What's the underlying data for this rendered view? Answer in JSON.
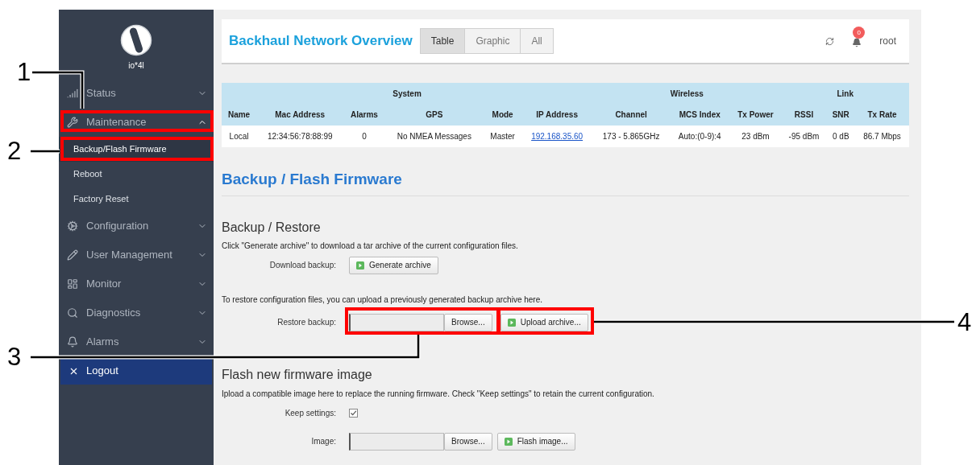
{
  "sidebar": {
    "logo_text": "io*4l",
    "items": [
      {
        "label": "Status",
        "expanded": false
      },
      {
        "label": "Maintenance",
        "expanded": true,
        "children": [
          {
            "label": "Backup/Flash Firmware",
            "selected": true
          },
          {
            "label": "Reboot",
            "selected": false
          },
          {
            "label": "Factory Reset",
            "selected": false
          }
        ]
      },
      {
        "label": "Configuration",
        "expanded": false
      },
      {
        "label": "User Management",
        "expanded": false
      },
      {
        "label": "Monitor",
        "expanded": false
      },
      {
        "label": "Diagnostics",
        "expanded": false
      },
      {
        "label": "Alarms",
        "expanded": false
      }
    ],
    "logout": "Logout"
  },
  "header": {
    "title": "Backhaul Network Overview",
    "tabs": [
      {
        "label": "Table",
        "selected": true
      },
      {
        "label": "Graphic",
        "selected": false
      },
      {
        "label": "All",
        "selected": false
      }
    ],
    "notification_count": "0",
    "user": "root"
  },
  "table": {
    "groups": [
      {
        "label": "System",
        "columns": [
          "Name",
          "Mac Address",
          "Alarms",
          "GPS",
          "Mode",
          "IP Address"
        ]
      },
      {
        "label": "Wireless",
        "columns": [
          "Channel",
          "MCS Index",
          "Tx Power"
        ]
      },
      {
        "label": "Link",
        "columns": [
          "RSSI",
          "SNR",
          "Tx Rate"
        ]
      }
    ],
    "rows": [
      [
        {
          "text": "Local",
          "kind": "text"
        },
        {
          "text": "12:34:56:78:88:99",
          "kind": "text"
        },
        {
          "text": "0",
          "kind": "text"
        },
        {
          "text": "No NMEA Messages",
          "kind": "text"
        },
        {
          "text": "Master",
          "kind": "text"
        },
        {
          "text": "192.168.35.60",
          "kind": "link"
        },
        {
          "text": "173 - 5.865GHz",
          "kind": "text"
        },
        {
          "text": "Auto:(0-9):4",
          "kind": "text"
        },
        {
          "text": "23 dBm",
          "kind": "text"
        },
        {
          "text": "-95 dBm",
          "kind": "text"
        },
        {
          "text": "0 dB",
          "kind": "text"
        },
        {
          "text": "86.7 Mbps",
          "kind": "text"
        }
      ]
    ]
  },
  "page_title": "Backup / Flash Firmware",
  "backup_restore": {
    "title": "Backup / Restore",
    "description": "Click \"Generate archive\" to download a tar archive of the current configuration files.",
    "download_label": "Download backup:",
    "generate_button": "Generate archive",
    "restore_description": "To restore configuration files, you can upload a previously generated backup archive here.",
    "restore_label": "Restore backup:",
    "browse_button": "Browse...",
    "upload_button": "Upload archive..."
  },
  "flash": {
    "title": "Flash new firmware image",
    "description": "Ipload a compatible image here to replace the running firmware. Check \"Keep settings\" to retain the current configuration.",
    "keep_label": "Keep settings:",
    "keep_checked": true,
    "image_label": "Image:",
    "browse_button": "Browse...",
    "flash_button": "Flash image..."
  },
  "callouts": [
    {
      "label": "1"
    },
    {
      "label": "2"
    },
    {
      "label": "3"
    },
    {
      "label": "4"
    }
  ]
}
